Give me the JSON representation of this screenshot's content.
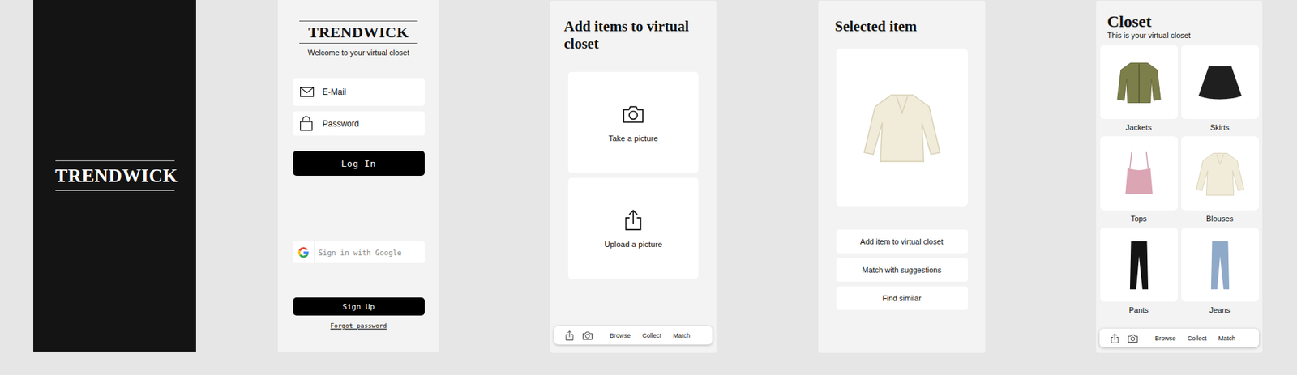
{
  "splash": {
    "logo": "TRENDWICK"
  },
  "login": {
    "logo": "TRENDWICK",
    "tagline": "Welcome to your virtual closet",
    "fields": [
      {
        "kind": "email",
        "placeholder": "E-Mail"
      },
      {
        "kind": "password",
        "placeholder": "Password"
      }
    ],
    "login_button": "Log In",
    "google_button": "Sign in with Google",
    "signup_button": "Sign Up",
    "forgot_link": "Forgot password"
  },
  "add_items": {
    "title": "Add items to virtual closet",
    "options": [
      {
        "kind": "camera",
        "label": "Take a picture"
      },
      {
        "kind": "upload",
        "label": "Upload a picture"
      }
    ],
    "nav": [
      "Browse",
      "Collect",
      "Match"
    ]
  },
  "selected_item": {
    "title": "Selected item",
    "item": {
      "kind": "blouse",
      "color": "#f1ecd9"
    },
    "actions": [
      "Add item to virtual closet",
      "Match with suggestions",
      "Find similar"
    ]
  },
  "closet": {
    "title": "Closet",
    "subtitle": "This is your virtual closet",
    "categories": [
      {
        "label": "Jackets",
        "kind": "jacket",
        "color": "#7d7f4a"
      },
      {
        "label": "Skirts",
        "kind": "skirt",
        "color": "#1f1f1f"
      },
      {
        "label": "Tops",
        "kind": "top",
        "color": "#dba5b4"
      },
      {
        "label": "Blouses",
        "kind": "blouse",
        "color": "#f1ecd9"
      },
      {
        "label": "Pants",
        "kind": "pants",
        "color": "#141414"
      },
      {
        "label": "Jeans",
        "kind": "jeans",
        "color": "#8fa9c9"
      }
    ],
    "nav": [
      "Browse",
      "Collect",
      "Match"
    ]
  }
}
